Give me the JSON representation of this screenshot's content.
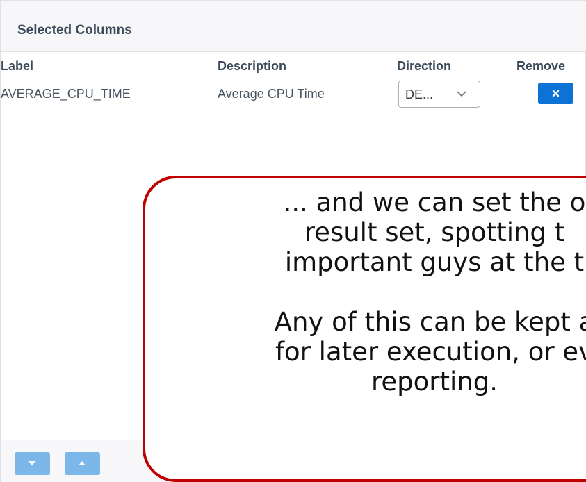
{
  "panel": {
    "title": "Selected Columns"
  },
  "table": {
    "headers": {
      "label": "Label",
      "description": "Description",
      "direction": "Direction",
      "remove": "Remove"
    },
    "rows": [
      {
        "label": "AVERAGE_CPU_TIME",
        "description": "Average CPU Time",
        "direction": "DE...",
        "remove_icon": "close-icon"
      }
    ]
  },
  "footer": {
    "buttons": [
      {
        "icon": "caret-down-icon"
      },
      {
        "icon": "caret-up-icon"
      }
    ]
  },
  "callout": {
    "lines": [
      "... and we can set the o",
      "result set, spotting t",
      "important guys at the t",
      "",
      "Any of this can be kept a",
      "for later execution, or ev",
      "reporting."
    ],
    "border_color": "#c00000"
  },
  "colors": {
    "primary_button": "#0c72d5",
    "disabled_button": "#7cb7ea"
  }
}
